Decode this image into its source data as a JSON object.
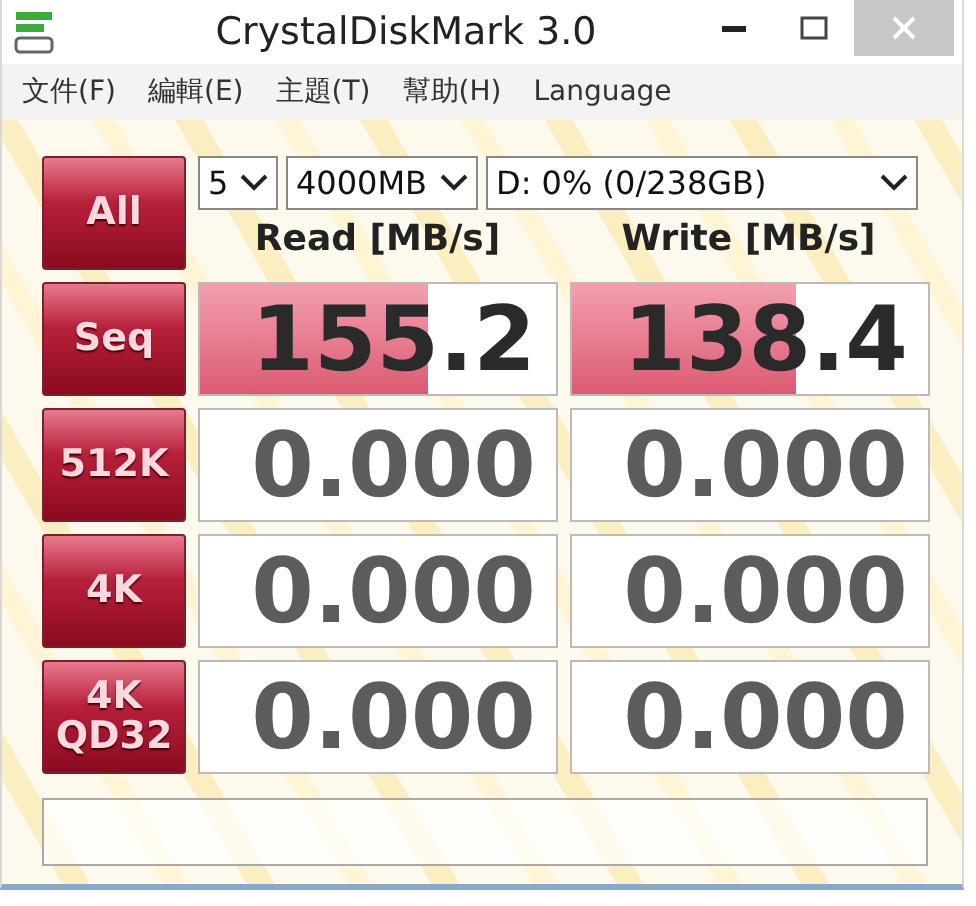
{
  "window": {
    "title": "CrystalDiskMark 3.0"
  },
  "menu": [
    "文件(F)",
    "編輯(E)",
    "主題(T)",
    "幫助(H)",
    "Language"
  ],
  "all_button": "All",
  "selects": [
    {
      "kind": "count",
      "value": "5"
    },
    {
      "kind": "size",
      "value": "4000MB"
    },
    {
      "kind": "drive",
      "value": "D: 0% (0/238GB)"
    }
  ],
  "headers": [
    "Read [MB/s]",
    "Write [MB/s]"
  ],
  "rows": [
    {
      "label": "Seq",
      "read": {
        "value": "155.2",
        "level": 0.64
      },
      "write": {
        "value": "138.4",
        "level": 0.63
      }
    },
    {
      "label": "512K",
      "read": {
        "value": "0.000"
      },
      "write": {
        "value": "0.000"
      }
    },
    {
      "label": "4K",
      "read": {
        "value": "0.000"
      },
      "write": {
        "value": "0.000"
      }
    },
    {
      "label": "4K QD32",
      "read": {
        "value": "0.000"
      },
      "write": {
        "value": "0.000"
      }
    }
  ]
}
